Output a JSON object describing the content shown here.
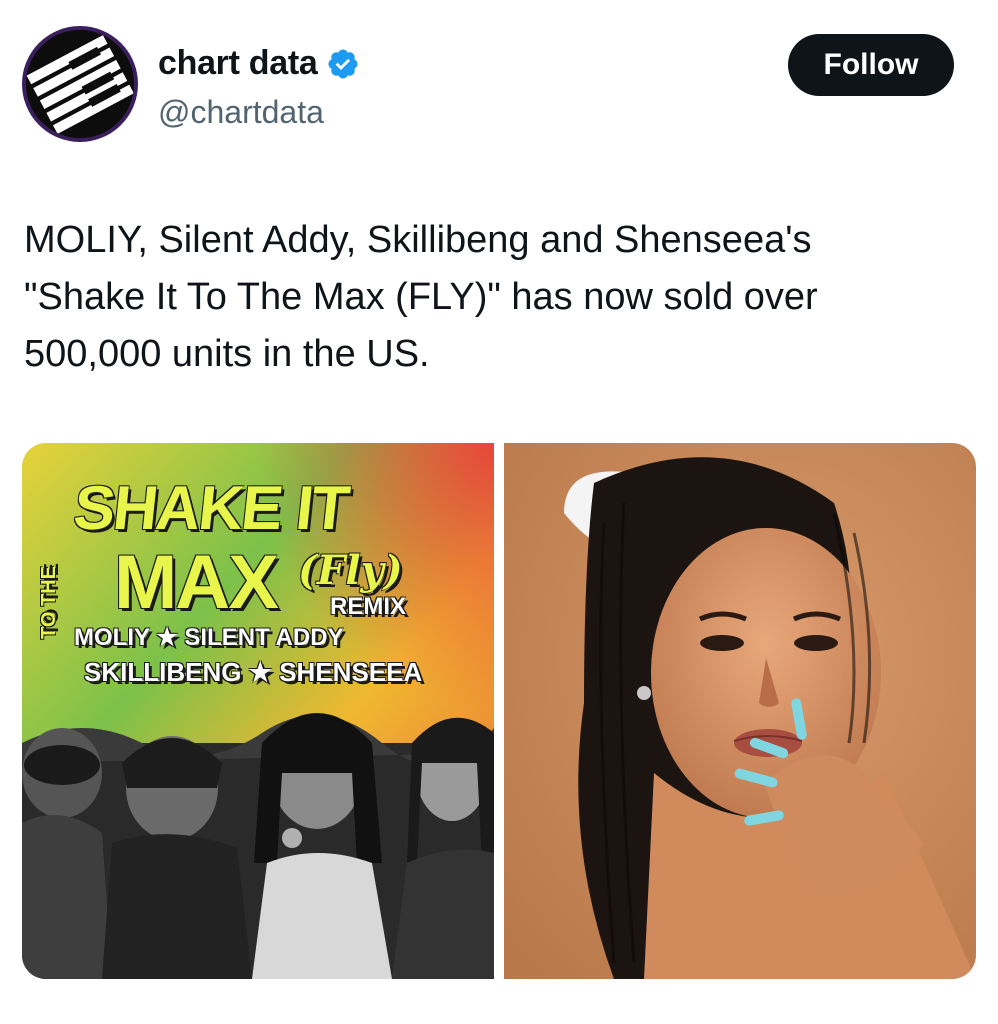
{
  "author": {
    "display_name": "chart data",
    "handle": "@chartdata",
    "verified_icon": "verified-badge-icon",
    "avatar_icon": "piano-keys-icon"
  },
  "actions": {
    "follow_label": "Follow"
  },
  "tweet": {
    "text": "MOLIY, Silent Addy, Skillibeng and Shenseea's\n\"Shake It To The Max (FLY)\" has now sold over\n500,000 units in the US."
  },
  "media": {
    "cover": {
      "title_line1": "SHAKE IT",
      "title_to_the": "TO THE",
      "title_max": "MAX",
      "title_fly": "(Fly)",
      "remix": "REMIX",
      "artists_line1": "MOLIY ★ SILENT ADDY",
      "artists_line2": "SKILLIBENG ★ SHENSEEA"
    }
  },
  "colors": {
    "accent_verified": "#1d9bf0",
    "follow_bg": "#0f1419",
    "text_primary": "#0f1419",
    "text_secondary": "#536471"
  }
}
